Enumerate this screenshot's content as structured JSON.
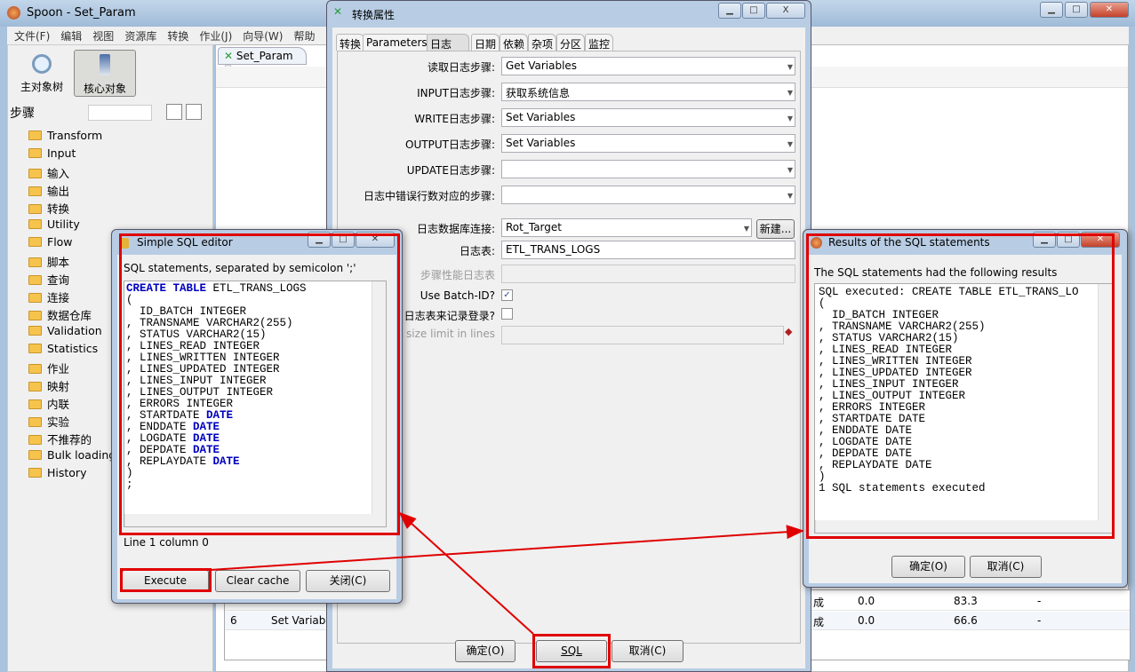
{
  "main_window": {
    "title": "Spoon - Set_Param",
    "menu": [
      "文件(F)",
      "编辑",
      "视图",
      "资源库",
      "转换",
      "作业(J)",
      "向导(W)",
      "帮助"
    ],
    "left_tabs": [
      "主对象树",
      "核心对象"
    ],
    "steps_label": "步骤",
    "tree": [
      "Transform",
      "Input",
      "输入",
      "输出",
      "转换",
      "Utility",
      "Flow",
      "脚本",
      "查询",
      "连接",
      "数据仓库",
      "Validation",
      "Statistics",
      "作业",
      "映射",
      "内联",
      "实验",
      "不推荐的",
      "Bulk loading",
      "History"
    ],
    "editor_tab": "Set_Param",
    "table_rows": [
      {
        "num": "",
        "name": "",
        "status": "成",
        "v1": "0.0",
        "v2": "83.3",
        "v3": "-"
      },
      {
        "num": "6",
        "name": "Set Variab",
        "status": "成",
        "v1": "0.0",
        "v2": "66.6",
        "v3": "-"
      }
    ]
  },
  "trans_dialog": {
    "title": "转换属性",
    "tabs": [
      "转换",
      "Parameters",
      "日志",
      "日期",
      "依赖",
      "杂项",
      "分区",
      "监控"
    ],
    "active_tab": "日志",
    "fields": [
      {
        "label": "读取日志步骤:",
        "value": "Get Variables"
      },
      {
        "label": "INPUT日志步骤:",
        "value": "获取系统信息"
      },
      {
        "label": "WRITE日志步骤:",
        "value": "Set Variables"
      },
      {
        "label": "OUTPUT日志步骤:",
        "value": "Set Variables"
      },
      {
        "label": "UPDATE日志步骤:",
        "value": ""
      },
      {
        "label": "日志中错误行数对应的步骤:",
        "value": ""
      }
    ],
    "db_conn_label": "日志数据库连接:",
    "db_conn_value": "Rot_Target",
    "new_button": "新建...",
    "log_table_label": "日志表:",
    "log_table_value": "ETL_TRANS_LOGS",
    "perf_label": "步骤性能日志表",
    "batch_label": "Use Batch-ID?",
    "batch_checked": true,
    "logfield_label": "日志表来记录登录?",
    "logfield_checked": false,
    "size_label": "g size limit in lines",
    "ok": "确定(O)",
    "sql": "SQL",
    "cancel": "取消(C)"
  },
  "sql_editor": {
    "title": "Simple SQL editor",
    "hint": "SQL statements, separated by semicolon ';'",
    "lines": [
      [
        "CREATE TABLE",
        " ETL_TRANS_LOGS"
      ],
      [
        "(",
        ""
      ],
      [
        "  ID_BATCH INTEGER",
        ""
      ],
      [
        ", TRANSNAME VARCHAR2(255)",
        ""
      ],
      [
        ", STATUS VARCHAR2(15)",
        ""
      ],
      [
        ", LINES_READ INTEGER",
        ""
      ],
      [
        ", LINES_WRITTEN INTEGER",
        ""
      ],
      [
        ", LINES_UPDATED INTEGER",
        ""
      ],
      [
        ", LINES_INPUT INTEGER",
        ""
      ],
      [
        ", LINES_OUTPUT INTEGER",
        ""
      ],
      [
        ", ERRORS INTEGER",
        ""
      ],
      [
        ", STARTDATE ",
        "DATE"
      ],
      [
        ", ENDDATE ",
        "DATE"
      ],
      [
        ", LOGDATE ",
        "DATE"
      ],
      [
        ", DEPDATE ",
        "DATE"
      ],
      [
        ", REPLAYDATE ",
        "DATE"
      ],
      [
        ")",
        ""
      ],
      [
        ";",
        ""
      ]
    ],
    "status": "Line 1 column 0",
    "execute": "Execute",
    "clear_cache": "Clear cache",
    "close": "关闭(C)"
  },
  "results": {
    "title": "Results of the SQL statements",
    "hint": "The SQL statements had the following results",
    "text": "SQL executed: CREATE TABLE ETL_TRANS_LO\n(\n  ID_BATCH INTEGER\n, TRANSNAME VARCHAR2(255)\n, STATUS VARCHAR2(15)\n, LINES_READ INTEGER\n, LINES_WRITTEN INTEGER\n, LINES_UPDATED INTEGER\n, LINES_INPUT INTEGER\n, LINES_OUTPUT INTEGER\n, ERRORS INTEGER\n, STARTDATE DATE\n, ENDDATE DATE\n, LOGDATE DATE\n, DEPDATE DATE\n, REPLAYDATE DATE\n)\n1 SQL statements executed",
    "ok": "确定(O)",
    "cancel": "取消(C)"
  },
  "colors": {
    "highlight": "#e00000",
    "keyword": "#0000c0"
  }
}
